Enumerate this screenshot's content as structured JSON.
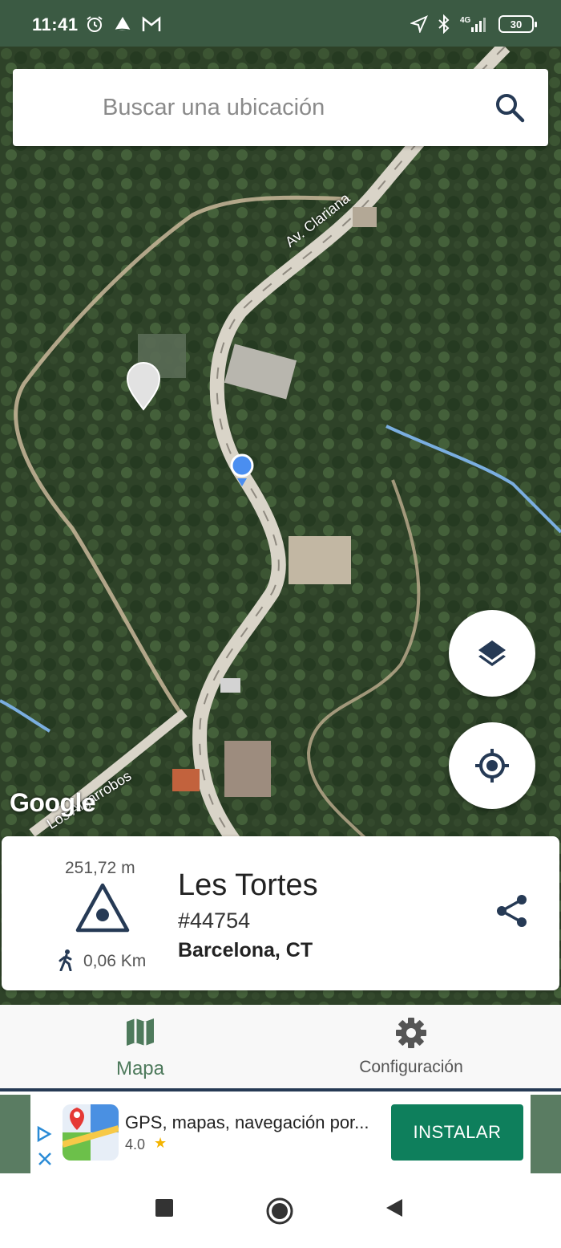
{
  "status_bar": {
    "time": "11:41",
    "network": "4G",
    "battery": "30",
    "left_icons": [
      "alarm-icon",
      "notification-icon",
      "gmail-icon"
    ],
    "right_icons": [
      "location-icon",
      "bluetooth-icon",
      "signal-icon",
      "battery-icon"
    ]
  },
  "search": {
    "placeholder": "Buscar una ubicación",
    "value": ""
  },
  "map": {
    "road_labels": [
      "Av. Clariana",
      "Los Algarrobos"
    ],
    "attribution": "Google",
    "buttons": [
      "layers-icon",
      "my-location-icon"
    ]
  },
  "info_card": {
    "elevation": "251,72 m",
    "distance": "0,06 Km",
    "name": "Les Tortes",
    "id": "#44754",
    "region": "Barcelona, CT"
  },
  "bottom_nav": {
    "items": [
      {
        "label": "Mapa",
        "icon": "map-icon",
        "active": true
      },
      {
        "label": "Configuración",
        "icon": "gear-icon",
        "active": false
      }
    ]
  },
  "ad": {
    "title": "GPS, mapas, navegación por...",
    "rating": "4.0",
    "install_label": "INSTALAR"
  },
  "colors": {
    "status_bar": "#3b5a43",
    "accent_green": "#4e7a5c",
    "navy": "#263a55",
    "install_green": "#0e7f5c"
  }
}
